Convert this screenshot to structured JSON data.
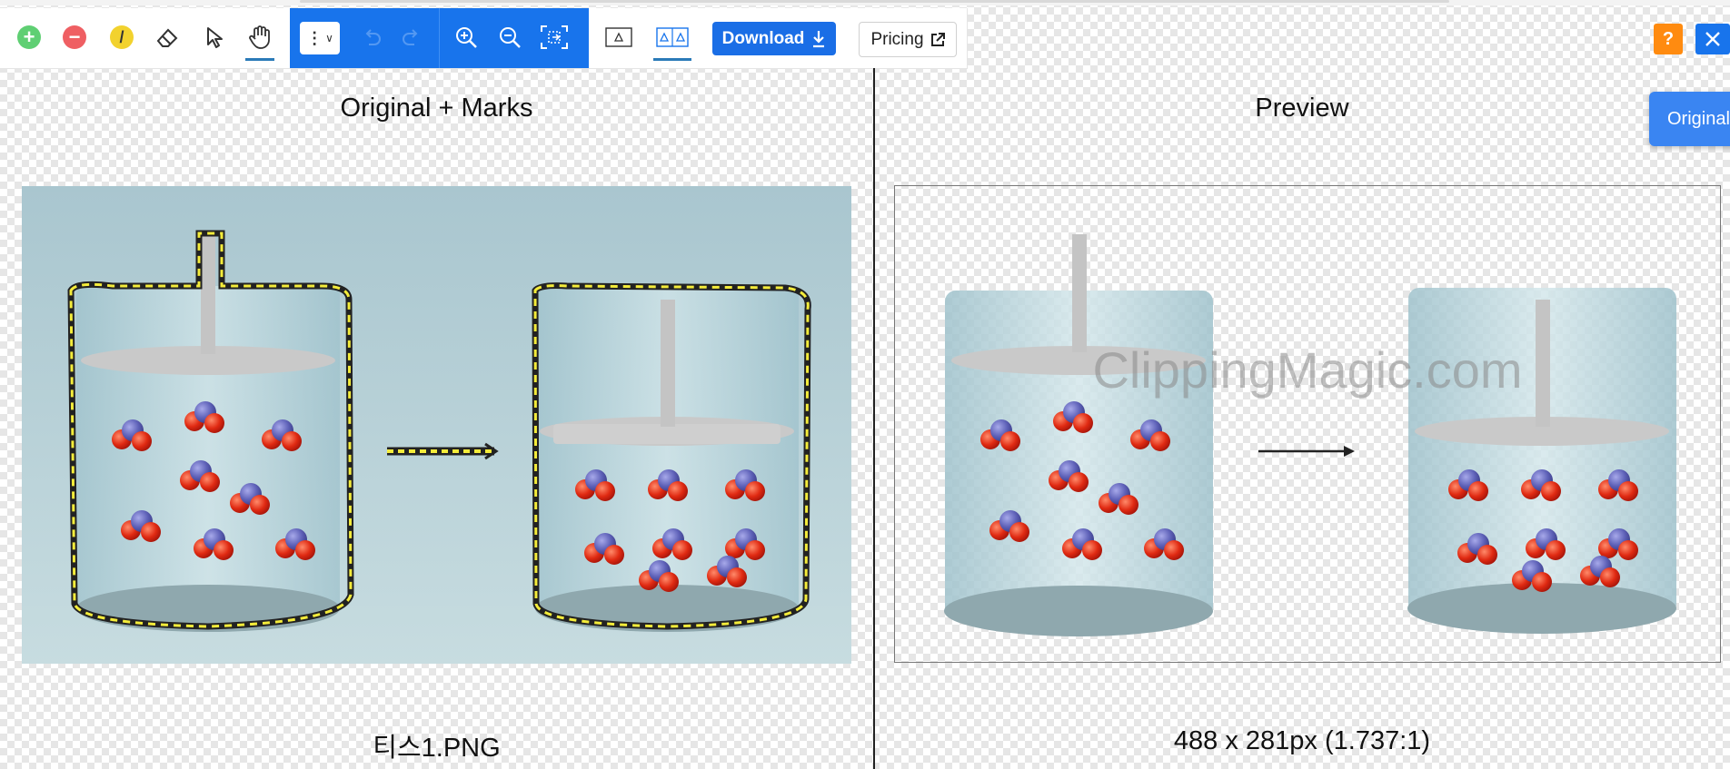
{
  "toolbar": {
    "tools": [
      {
        "name": "keep-marker",
        "icon": "plus-circle-icon",
        "color": "#5fcf73"
      },
      {
        "name": "remove-marker",
        "icon": "minus-circle-icon",
        "color": "#ef5f63"
      },
      {
        "name": "hair-marker",
        "icon": "pencil-circle-icon",
        "color": "#f2d22e"
      },
      {
        "name": "eraser",
        "icon": "eraser-icon"
      },
      {
        "name": "select",
        "icon": "arrow-pointer-icon"
      },
      {
        "name": "pan",
        "icon": "hand-icon",
        "active": true
      }
    ],
    "blue_group_color": "#1874ec",
    "menu_icon": "vertical-dots-icon",
    "undo_icon": "undo-icon",
    "redo_icon": "redo-icon",
    "zoom_in_icon": "zoom-in-icon",
    "zoom_out_icon": "zoom-out-icon",
    "fit_icon": "fit-screen-icon",
    "view_single_icon": "single-view-icon",
    "view_split_icon": "split-view-icon",
    "download_label": "Download",
    "download_icon": "download-arrow-icon",
    "pricing_label": "Pricing",
    "pricing_icon": "external-link-icon",
    "help_label": "?",
    "help_color": "#ff8b10",
    "close_icon": "close-icon"
  },
  "left_panel": {
    "title": "Original + Marks",
    "caption": "티스1.PNG"
  },
  "right_panel": {
    "title": "Preview",
    "caption": "488 x 281px (1.737:1)",
    "watermark": "ClippingMagic.com",
    "side_tab_label": "Original"
  }
}
